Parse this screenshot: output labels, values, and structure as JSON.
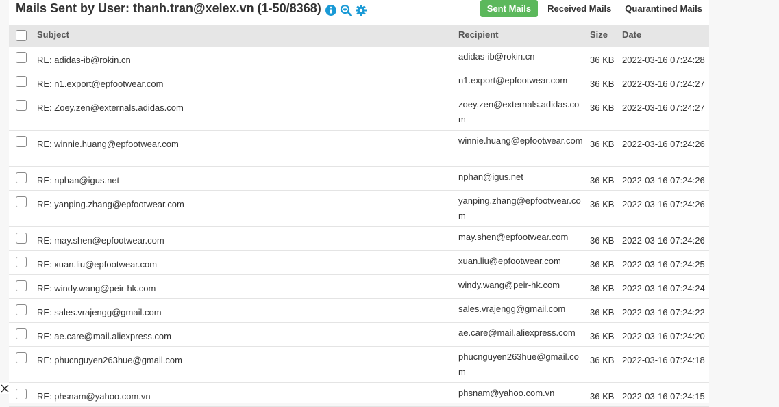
{
  "header": {
    "title": "Mails Sent by User: thanh.tran@xelex.vn (1-50/8368)",
    "icons": [
      "info-icon",
      "zoom-in-icon",
      "gear-icon"
    ]
  },
  "tabs": [
    {
      "label": "Sent Mails",
      "active": true
    },
    {
      "label": "Received Mails",
      "active": false
    },
    {
      "label": "Quarantined Mails",
      "active": false
    }
  ],
  "table": {
    "columns": {
      "subject": "Subject",
      "recipient": "Recipient",
      "size": "Size",
      "date": "Date"
    },
    "rows": [
      {
        "subject": "RE: adidas-ib@rokin.cn",
        "recipient": "adidas-ib@rokin.cn",
        "size": "36 KB",
        "date": "2022-03-16 07:24:28"
      },
      {
        "subject": "RE: n1.export@epfootwear.com",
        "recipient": "n1.export@epfootwear.com",
        "size": "36 KB",
        "date": "2022-03-16 07:24:27"
      },
      {
        "subject": "RE: Zoey.zen@externals.adidas.com",
        "recipient": "zoey.zen@externals.adidas.com",
        "size": "36 KB",
        "date": "2022-03-16 07:24:27"
      },
      {
        "subject": "RE: winnie.huang@epfootwear.com",
        "recipient": "winnie.huang@epfootwear.com",
        "size": "36 KB",
        "date": "2022-03-16 07:24:26"
      },
      {
        "subject": "RE: nphan@igus.net",
        "recipient": "nphan@igus.net",
        "size": "36 KB",
        "date": "2022-03-16 07:24:26"
      },
      {
        "subject": "RE: yanping.zhang@epfootwear.com",
        "recipient": "yanping.zhang@epfootwear.com",
        "size": "36 KB",
        "date": "2022-03-16 07:24:26"
      },
      {
        "subject": "RE: may.shen@epfootwear.com",
        "recipient": "may.shen@epfootwear.com",
        "size": "36 KB",
        "date": "2022-03-16 07:24:26"
      },
      {
        "subject": "RE: xuan.liu@epfootwear.com",
        "recipient": "xuan.liu@epfootwear.com",
        "size": "36 KB",
        "date": "2022-03-16 07:24:25"
      },
      {
        "subject": "RE: windy.wang@peir-hk.com",
        "recipient": "windy.wang@peir-hk.com",
        "size": "36 KB",
        "date": "2022-03-16 07:24:24"
      },
      {
        "subject": "RE: sales.vrajengg@gmail.com",
        "recipient": "sales.vrajengg@gmail.com",
        "size": "36 KB",
        "date": "2022-03-16 07:24:22"
      },
      {
        "subject": "RE: ae.care@mail.aliexpress.com",
        "recipient": "ae.care@mail.aliexpress.com",
        "size": "36 KB",
        "date": "2022-03-16 07:24:20"
      },
      {
        "subject": "RE: phucnguyen263hue@gmail.com",
        "recipient": "phucnguyen263hue@gmail.com",
        "size": "36 KB",
        "date": "2022-03-16 07:24:18"
      },
      {
        "subject": "RE: phsnam@yahoo.com.vn",
        "recipient": "phsnam@yahoo.com.vn",
        "size": "36 KB",
        "date": "2022-03-16 07:24:15"
      }
    ]
  },
  "colors": {
    "accent": "#5cb85c",
    "icon": "#1a9ad6",
    "header_bg": "#e6e6e6"
  }
}
